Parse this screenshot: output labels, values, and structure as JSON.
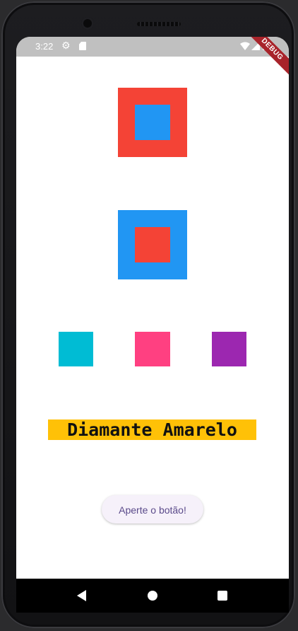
{
  "status_bar": {
    "time": "3:22",
    "icons": [
      "gear-icon",
      "sd-card-icon",
      "wifi-icon",
      "signal-icon",
      "battery-icon"
    ]
  },
  "debug_banner": {
    "label": "DEBUG"
  },
  "squares": {
    "first": {
      "outer_color": "#f44336",
      "inner_color": "#2196f3"
    },
    "second": {
      "outer_color": "#2196f3",
      "inner_color": "#f44336"
    },
    "row": [
      "#00bcd4",
      "#ff4081",
      "#9c27b0"
    ]
  },
  "title": {
    "text": "Diamante Amarelo",
    "background": "#ffc107"
  },
  "button": {
    "label": "Aperte o botão!"
  },
  "nav_bar": {
    "icons": [
      "back-icon",
      "home-icon",
      "recents-icon"
    ]
  }
}
